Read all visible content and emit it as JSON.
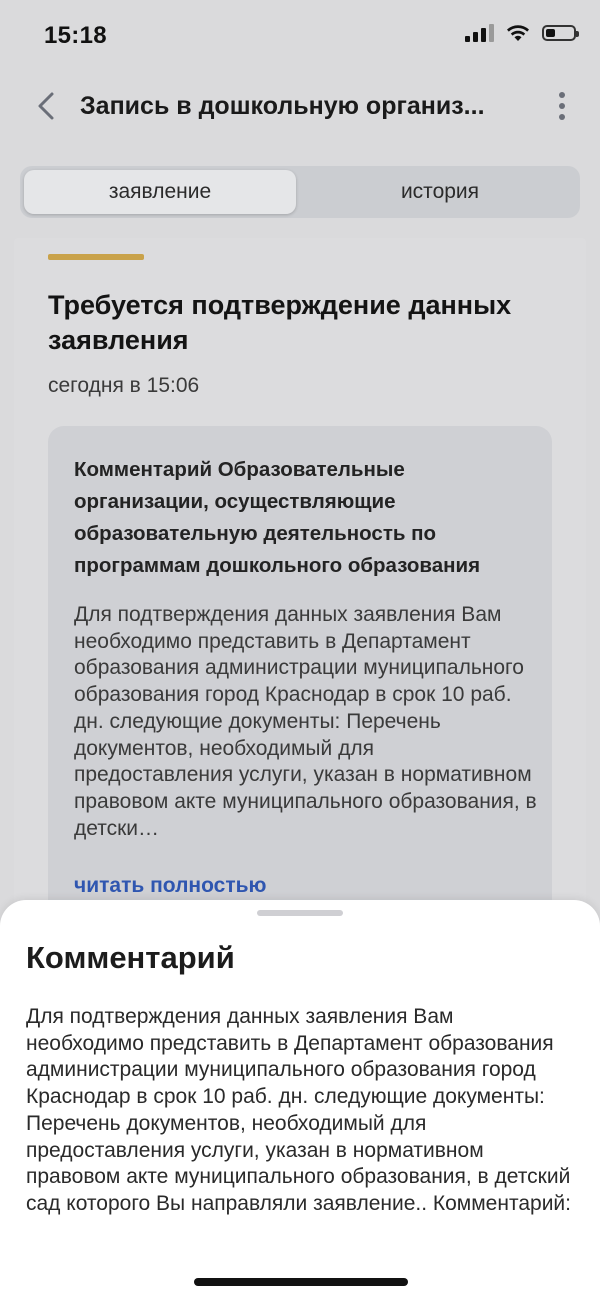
{
  "status_bar": {
    "time": "15:18"
  },
  "header": {
    "title": "Запись в дошкольную организ...",
    "back_icon": "chevron-left-icon",
    "more_icon": "more-vertical-icon"
  },
  "tabs": [
    {
      "label": "заявление",
      "active": true
    },
    {
      "label": "история",
      "active": false
    }
  ],
  "card": {
    "accent_color": "#c9a24a",
    "title": "Требуется подтверждение данных заявления",
    "date": "сегодня в 15:06",
    "comment": {
      "title": "Комментарий Образовательные организации, осуществляющие образовательную деятельность по программам дошкольного образования",
      "text": "Для подтверждения данных заявления Вам необходимо представить в Департамент образования администрации муниципального образования город Краснодар в срок 10 раб. дн. следующие документы: Перечень документов, необходимый для предоставления услуги, указан в нормативном правовом акте муниципального образования, в детски…",
      "read_more": "читать полностью"
    }
  },
  "sheet": {
    "title": "Комментарий",
    "text": "Для подтверждения данных заявления Вам необходимо представить в Департамент образования администрации муниципального образования город Краснодар в срок 10 раб. дн. следующие документы: Перечень документов, необходимый для предоставления услуги, указан в нормативном правовом акте муниципального образования, в детский сад которого Вы направляли заявление.. Комментарий:"
  }
}
